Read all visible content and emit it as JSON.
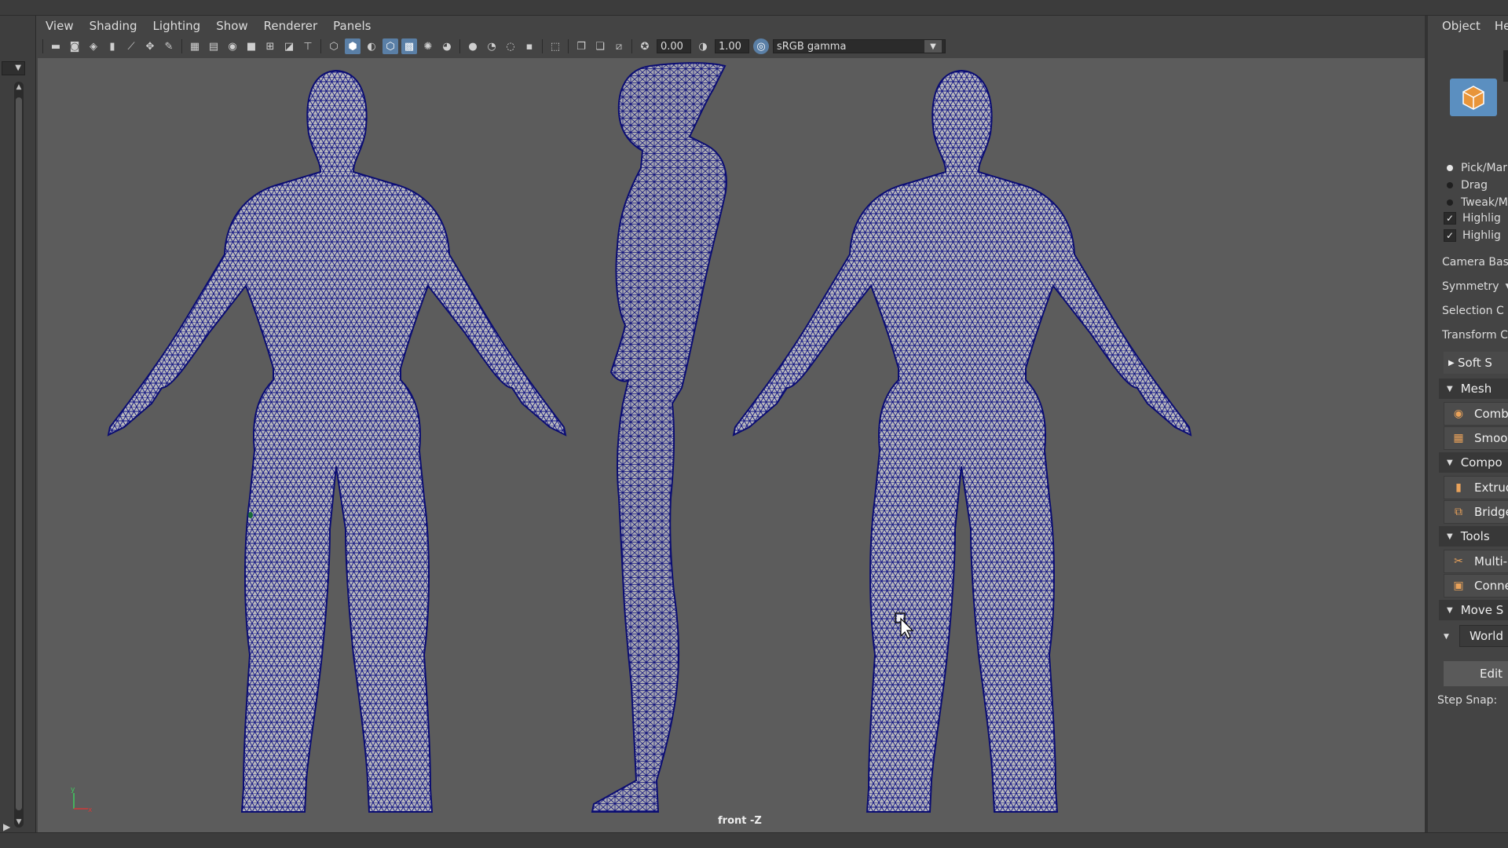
{
  "menu": [
    "View",
    "Shading",
    "Lighting",
    "Show",
    "Renderer",
    "Panels"
  ],
  "toolbar": {
    "exposure_value": "0.00",
    "gamma_value": "1.00",
    "color_space": "sRGB gamma"
  },
  "viewport": {
    "camera_label": "front -Z",
    "mesh_color": "#0d0f7a",
    "background_color": "#5c5c5c"
  },
  "right_panel": {
    "tabs": [
      "Object",
      "He"
    ],
    "radio_options": [
      "Pick/Mar",
      "Drag",
      "Tweak/M"
    ],
    "checkbox_options": [
      "Highlig",
      "Highlig"
    ],
    "settings": [
      "Camera Bas",
      "Symmetry",
      "Selection C",
      "Transform C"
    ],
    "soft_select_label": "Soft S",
    "sections": {
      "mesh": "Mesh",
      "components": "Compo",
      "tools": "Tools",
      "move_settings": "Move S"
    },
    "mesh_tools": [
      "Combi",
      "Smoot"
    ],
    "component_tools": [
      "Extrud",
      "Bridge"
    ],
    "tool_tools": [
      "Multi-",
      "Conne"
    ],
    "world_label": "World",
    "edit_button": "Edit",
    "step_snap": "Step Snap:"
  }
}
